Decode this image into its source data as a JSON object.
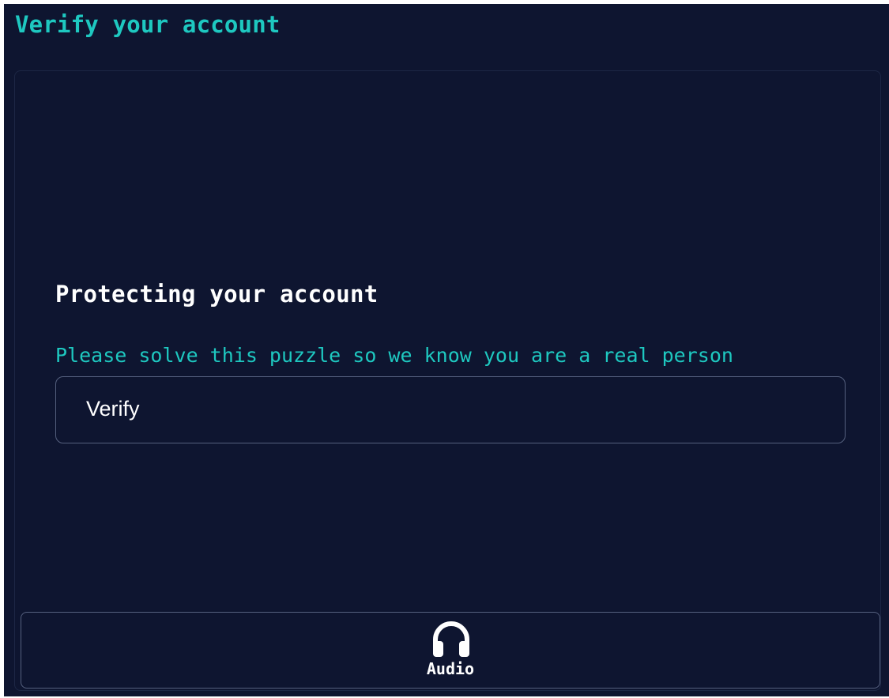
{
  "header": {
    "title": "Verify your account"
  },
  "challenge": {
    "heading": "Protecting your account",
    "instructions": "Please solve this puzzle so we know you are a real person",
    "verify_label": "Verify"
  },
  "footer": {
    "audio_label": "Audio",
    "audio_icon": "headphones-icon"
  },
  "colors": {
    "background": "#0e1530",
    "accent": "#1ec8c0",
    "text": "#ffffff",
    "border": "#55607e"
  }
}
